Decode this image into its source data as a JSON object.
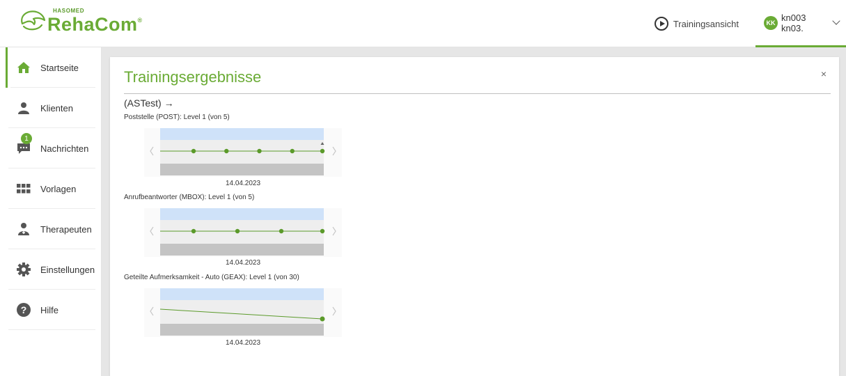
{
  "app": {
    "brand_small": "HASOMED",
    "brand_name": "RehaCom",
    "brand_reg": "®"
  },
  "header": {
    "training_view_label": "Trainingsansicht",
    "user_initials": "KK",
    "user_name": "kn003 kn03."
  },
  "sidebar": {
    "items": [
      {
        "label": "Startseite",
        "icon": "home-icon",
        "active": true
      },
      {
        "label": "Klienten",
        "icon": "person-icon"
      },
      {
        "label": "Nachrichten",
        "icon": "message-icon",
        "badge": "1"
      },
      {
        "label": "Vorlagen",
        "icon": "grid-icon"
      },
      {
        "label": "Therapeuten",
        "icon": "therapist-icon"
      },
      {
        "label": "Einstellungen",
        "icon": "gear-icon"
      },
      {
        "label": "Hilfe",
        "icon": "help-icon"
      }
    ]
  },
  "panel": {
    "title": "Trainingsergebnisse",
    "close": "×",
    "group": "(ASTest) →"
  },
  "modules": [
    {
      "label": "Poststelle (POST): Level 1 (von 5)",
      "y_tick": "1",
      "date": "14.04.2023",
      "points": [
        1,
        1,
        1,
        1,
        1
      ]
    },
    {
      "label": "Anrufbeantworter (MBOX): Level 1 (von 5)",
      "y_tick": "1",
      "date": "14.04.2023",
      "points": [
        1,
        1,
        1,
        1
      ]
    },
    {
      "label": "Geteilte Aufmerksamkeit - Auto (GEAX): Level 1 (von 30)",
      "y_tick": "1",
      "date": "14.04.2023",
      "points": [
        1
      ]
    }
  ],
  "colors": {
    "accent": "#6aab35",
    "chart_top_band": "#cfe2f9",
    "chart_mid_band": "#eeeeee",
    "chart_bottom_band": "#c4c4c4",
    "chart_point": "#5b9a2a"
  }
}
